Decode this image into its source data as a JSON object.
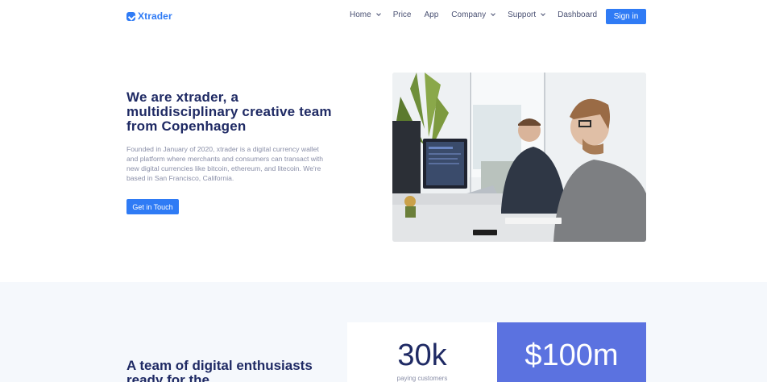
{
  "nav": {
    "brand": "Xtrader",
    "items": [
      {
        "label": "Home",
        "dropdown": true
      },
      {
        "label": "Price",
        "dropdown": false
      },
      {
        "label": "App",
        "dropdown": false
      },
      {
        "label": "Company",
        "dropdown": true
      },
      {
        "label": "Support",
        "dropdown": true
      },
      {
        "label": "Dashboard",
        "dropdown": false
      }
    ],
    "signin": "Sign in"
  },
  "hero": {
    "title": "We are xtrader, a multidisciplinary creative team from Copenhagen",
    "text": "Founded in January of 2020, xtrader is a digital currency wallet and platform where merchants and consumers can transact with new digital currencies like bitcoin, ethereum, and litecoin. We're based in San Francisco, California.",
    "button": "Get in Touch"
  },
  "team": {
    "title": "A team of digital enthusiasts ready for the"
  },
  "stats": [
    {
      "value": "30k",
      "label": "paying customers"
    },
    {
      "value": "$100m",
      "label": ""
    }
  ],
  "colors": {
    "accent": "#2f7bf5",
    "heading": "#1f2a64",
    "stat_highlight": "#5b72e0",
    "section_bg": "#f5f8fc"
  }
}
